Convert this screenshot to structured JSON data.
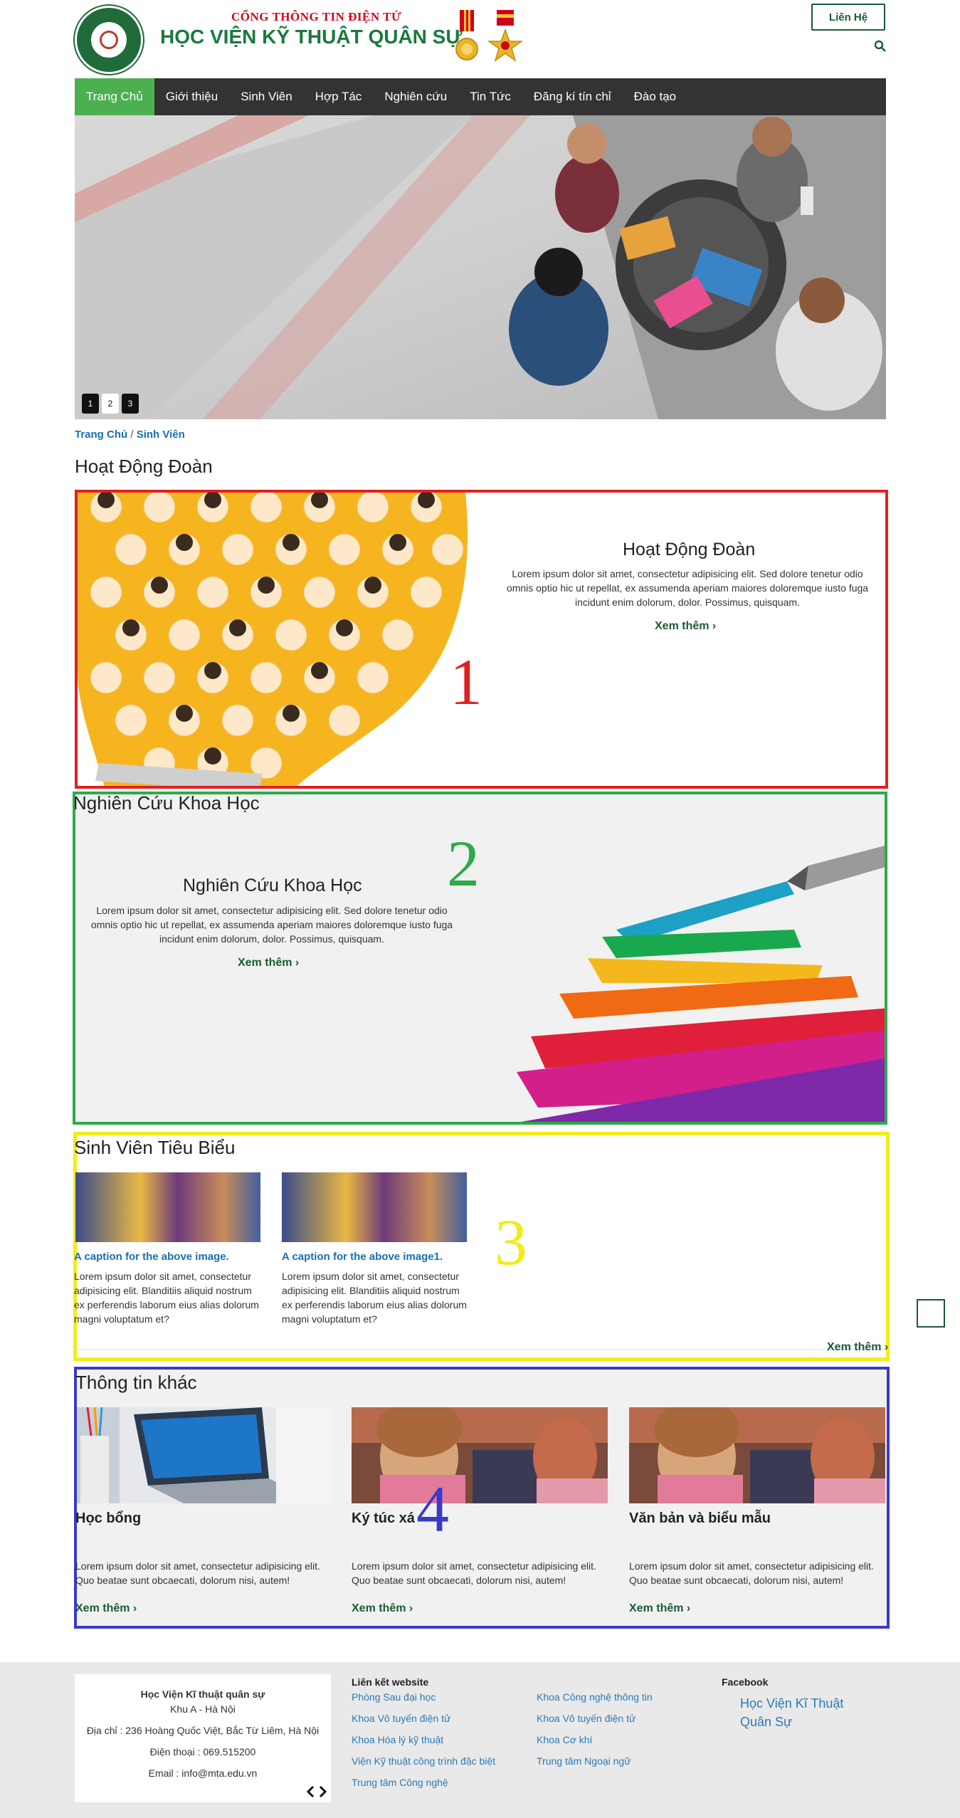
{
  "header": {
    "brand_top": "CỔNG THÔNG TIN ĐIỆN TỬ",
    "brand_main": "HỌC VIỆN KỸ THUẬT QUÂN SỰ",
    "contact_button": "Liên Hệ"
  },
  "nav": {
    "items": [
      "Trang Chủ",
      "Giới thiệu",
      "Sinh Viên",
      "Hợp Tác",
      "Nghiên cứu",
      "Tin Tức",
      "Đăng kí tín chỉ",
      "Đào tạo"
    ]
  },
  "slider": {
    "dots": [
      "1",
      "2",
      "3"
    ]
  },
  "breadcrumb": {
    "home": "Trang Chủ",
    "sep": " / ",
    "current": "Sinh Viên"
  },
  "section1": {
    "heading": "Hoạt Động Đoàn",
    "title": "Hoạt Động Đoàn",
    "text": "Lorem ipsum dolor sit amet, consectetur adipisicing elit. Sed dolore tenetur odio omnis optio hic ut repellat, ex assumenda aperiam maiores doloremque iusto fuga incidunt enim dolorum, dolor. Possimus, quisquam.",
    "more": "Xem thêm",
    "number": "1"
  },
  "section2": {
    "heading": "Nghiên Cứu Khoa Học",
    "title": "Nghiên Cứu Khoa Học",
    "text": "Lorem ipsum dolor sit amet, consectetur adipisicing elit. Sed dolore tenetur odio omnis optio hic ut repellat, ex assumenda aperiam maiores doloremque iusto fuga incidunt enim dolorum, dolor. Possimus, quisquam.",
    "more": "Xem thêm",
    "number": "2"
  },
  "section3": {
    "heading": "Sinh Viên Tiêu Biểu",
    "cards": [
      {
        "caption": "A caption for the above image.",
        "text": "Lorem ipsum dolor sit amet, consectetur adipisicing elit. Blanditiis aliquid nostrum ex perferendis laborum eius alias dolorum magni voluptatum et?"
      },
      {
        "caption": "A caption for the above image1.",
        "text": "Lorem ipsum dolor sit amet, consectetur adipisicing elit. Blanditiis aliquid nostrum ex perferendis laborum eius alias dolorum magni voluptatum et?"
      }
    ],
    "more": "Xem thêm",
    "number": "3"
  },
  "section4": {
    "heading": "Thông tin khác",
    "items": [
      {
        "title": "Học bổng",
        "text": "Lorem ipsum dolor sit amet, consectetur adipisicing elit. Quo beatae sunt obcaecati, dolorum nisi, autem!",
        "more": "Xem thêm"
      },
      {
        "title": "Ký túc xá",
        "text": "Lorem ipsum dolor sit amet, consectetur adipisicing elit. Quo beatae sunt obcaecati, dolorum nisi, autem!",
        "more": "Xem thêm"
      },
      {
        "title": "Văn bản và biểu mẫu",
        "text": "Lorem ipsum dolor sit amet, consectetur adipisicing elit. Quo beatae sunt obcaecati, dolorum nisi, autem!",
        "more": "Xem thêm"
      }
    ],
    "number": "4"
  },
  "footer": {
    "org_name": "Học Viện Kĩ thuật quân sự",
    "area": "Khu A - Hà Nội",
    "address": "Địa chỉ : 236 Hoàng Quốc Việt, Bắc Từ Liêm, Hà Nội",
    "phone": "Điện thoại : 069.515200",
    "email": "Email : info@mta.edu.vn",
    "links_heading": "Liên kết website",
    "links_col1": [
      "Phòng Sau đại học",
      "Khoa Vô tuyến điện tử",
      "Khoa Hóa lý kỹ thuật",
      "Viện Kỹ thuật công trình đặc biệt",
      "Trung tâm Công nghệ"
    ],
    "links_col2": [
      "Khoa Công nghệ thông tin",
      "Khoa Vô tuyến điện tử",
      "Khoa Cơ khí",
      "Trung tâm Ngoại ngữ"
    ],
    "facebook_heading": "Facebook",
    "facebook_link": "Học Viện Kĩ Thuật Quân Sự"
  },
  "colors": {
    "nav_bg": "#333333",
    "nav_active": "#4caf50",
    "brand_green": "#1a7a3e",
    "brand_red": "#d0021b",
    "link_blue": "#1a6fb0",
    "box1_border": "#e02020",
    "box2_border": "#2eaa4a",
    "box3_border": "#f2ec1a",
    "box4_border": "#3a3ac8"
  }
}
